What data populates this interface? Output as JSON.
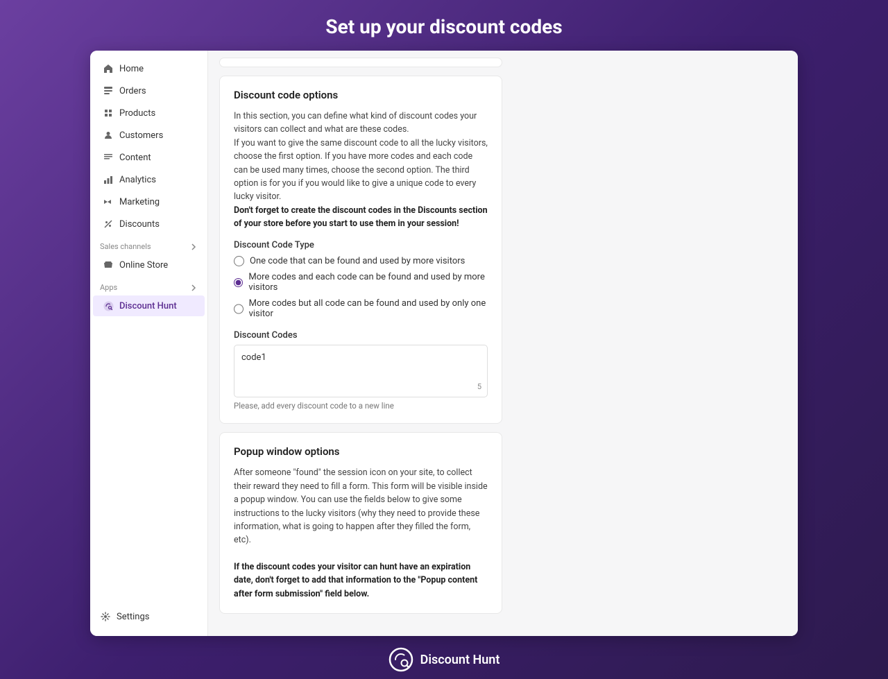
{
  "header": {
    "title": "Set up your discount codes"
  },
  "sidebar": {
    "items": [
      {
        "label": "Home",
        "icon": "home",
        "active": false
      },
      {
        "label": "Orders",
        "icon": "orders",
        "active": false
      },
      {
        "label": "Products",
        "icon": "products",
        "active": false
      },
      {
        "label": "Customers",
        "icon": "customers",
        "active": false
      },
      {
        "label": "Content",
        "icon": "content",
        "active": false
      },
      {
        "label": "Analytics",
        "icon": "analytics",
        "active": false
      },
      {
        "label": "Marketing",
        "icon": "marketing",
        "active": false
      },
      {
        "label": "Discounts",
        "icon": "discounts",
        "active": false
      }
    ],
    "sales_channels_label": "Sales channels",
    "sales_channels": [
      {
        "label": "Online Store",
        "icon": "store",
        "active": false
      }
    ],
    "apps_label": "Apps",
    "apps": [
      {
        "label": "Discount Hunt",
        "icon": "discount-hunt",
        "active": true
      }
    ],
    "settings_label": "Settings"
  },
  "discount_code_options": {
    "section_title": "Discount code options",
    "description1": "In this section, you can define what kind of discount codes your visitors can collect and what are these codes.",
    "description2": "If you want to give the same discount code to all the lucky visitors, choose the first option. If you have more codes and each code can be used many times, choose the second option. The third option is for you if you would like to give a unique code to every lucky visitor.",
    "bold_note": "Don't forget to create the discount codes in the Discounts section of your store before you start to use them in your session!",
    "code_type_label": "Discount Code Type",
    "radio_options": [
      {
        "label": "One code that can be found and used by more visitors",
        "value": "one_code",
        "checked": false
      },
      {
        "label": "More codes and each code can be found and used by more visitors",
        "value": "more_codes_multi",
        "checked": true
      },
      {
        "label": "More codes but all code can be found and used by only one visitor",
        "value": "more_codes_unique",
        "checked": false
      }
    ],
    "codes_label": "Discount Codes",
    "codes_value": "code1",
    "codes_placeholder": "",
    "char_count": "5",
    "hint_text": "Please, add every discount code to a new line"
  },
  "popup_window_options": {
    "section_title": "Popup window options",
    "description1": "After someone \"found\" the session icon on your site, to collect their reward they need to fill a form. This form will be visible inside a popup window. You can use the fields below to give some instructions to the lucky visitors (why they need to provide these information, what is going to happen after they filled the form, etc).",
    "bold_note2": "If the discount codes your visitor can hunt have an expiration date, don't forget to add that information to the \"Popup content after form submission\" field below."
  },
  "footer": {
    "label": "Discount Hunt",
    "icon": "discount-hunt-icon"
  }
}
